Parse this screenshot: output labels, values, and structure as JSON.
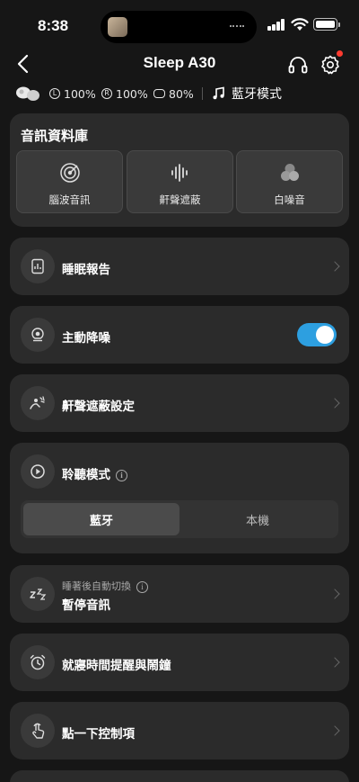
{
  "status_bar": {
    "time": "8:38"
  },
  "header": {
    "title": "Sleep A30",
    "back_icon": "chevron-left-icon",
    "headphones_icon": "headphones-icon",
    "settings_icon": "gear-icon",
    "notification_color": "#ff3b30"
  },
  "device": {
    "left_battery": "100%",
    "right_battery": "100%",
    "case_battery": "80%",
    "mode": "藍牙模式"
  },
  "library": {
    "title": "音訊資料庫",
    "tiles": [
      {
        "label": "腦波音訊",
        "icon": "brainwave-target-icon"
      },
      {
        "label": "鼾聲遮蔽",
        "icon": "soundwave-icon"
      },
      {
        "label": "白噪音",
        "icon": "circles-icon"
      }
    ]
  },
  "rows": {
    "sleep_report": "睡眠報告",
    "anc": "主動降噪",
    "anc_on": true,
    "snore_settings": "鼾聲遮蔽設定",
    "listen_mode": "聆聽模式",
    "auto_switch_sub": "睡著後自動切換",
    "auto_switch_value": "暫停音訊",
    "bedtime": "就寢時間提醒與鬧鐘",
    "tap_controls": "點一下控制項"
  },
  "listen_mode_options": [
    "藍牙",
    "本機"
  ],
  "listen_mode_selected": "藍牙",
  "colors": {
    "accent": "#2d9fe0",
    "card": "#2b2b2b",
    "background": "#161616"
  }
}
